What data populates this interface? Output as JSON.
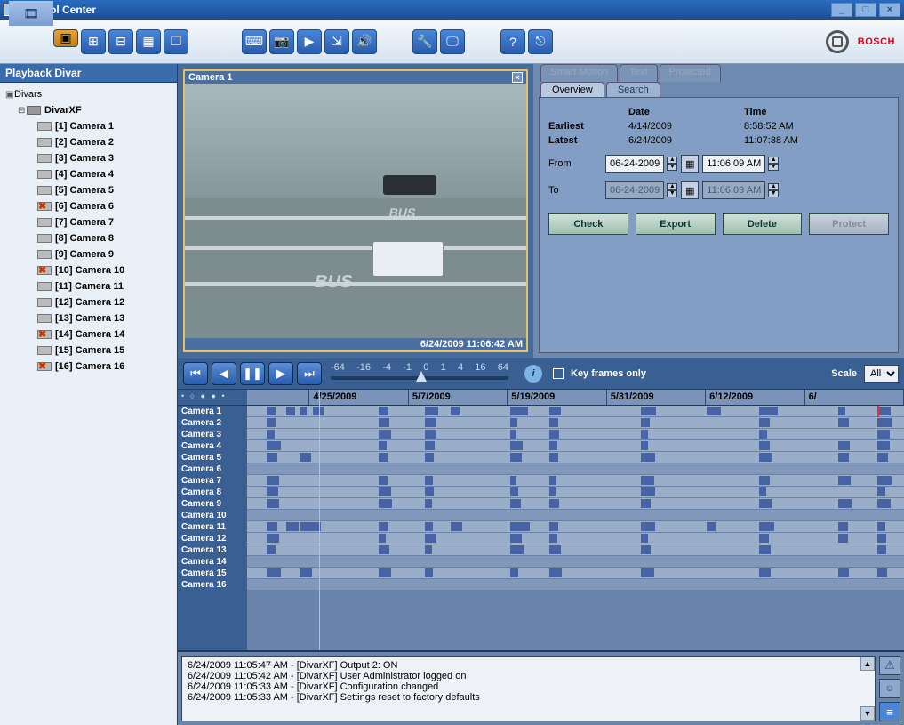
{
  "window": {
    "title": "Control Center"
  },
  "brand": "BOSCH",
  "sidebar": {
    "header": "Playback Divar",
    "root": "Divars",
    "device": "DivarXF",
    "cameras": [
      {
        "label": "[1] Camera 1",
        "off": false
      },
      {
        "label": "[2] Camera 2",
        "off": false
      },
      {
        "label": "[3] Camera 3",
        "off": false
      },
      {
        "label": "[4] Camera 4",
        "off": false
      },
      {
        "label": "[5] Camera 5",
        "off": false
      },
      {
        "label": "[6] Camera 6",
        "off": true
      },
      {
        "label": "[7] Camera 7",
        "off": false
      },
      {
        "label": "[8] Camera 8",
        "off": false
      },
      {
        "label": "[9] Camera 9",
        "off": false
      },
      {
        "label": "[10] Camera 10",
        "off": true
      },
      {
        "label": "[11] Camera 11",
        "off": false
      },
      {
        "label": "[12] Camera 12",
        "off": false
      },
      {
        "label": "[13] Camera 13",
        "off": false
      },
      {
        "label": "[14] Camera 14",
        "off": true
      },
      {
        "label": "[15] Camera 15",
        "off": false
      },
      {
        "label": "[16] Camera 16",
        "off": true
      }
    ]
  },
  "video": {
    "title": "Camera 1",
    "timestamp": "6/24/2009 11:06:42 AM"
  },
  "rtabs": {
    "smart": "Smart Motion",
    "text": "Text",
    "protected": "Protected",
    "overview": "Overview",
    "search": "Search"
  },
  "overview": {
    "hdr_date": "Date",
    "hdr_time": "Time",
    "earliest_lbl": "Earliest",
    "earliest_date": "4/14/2009",
    "earliest_time": "8:58:52 AM",
    "latest_lbl": "Latest",
    "latest_date": "6/24/2009",
    "latest_time": "11:07:38 AM",
    "from_lbl": "From",
    "from_date": "06-24-2009",
    "from_time": "11:06:09 AM",
    "to_lbl": "To",
    "to_date": "06-24-2009",
    "to_time": "11:06:09 AM",
    "btn_check": "Check",
    "btn_export": "Export",
    "btn_delete": "Delete",
    "btn_protect": "Protect"
  },
  "playback": {
    "ticks": [
      "-64",
      "-16",
      "-4",
      "-1",
      "0",
      "1",
      "4",
      "16",
      "64"
    ],
    "keyframes": "Key frames only",
    "scale_lbl": "Scale",
    "scale_val": "All"
  },
  "timeline": {
    "dates": [
      "4/25/2009",
      "5/7/2009",
      "5/19/2009",
      "5/31/2009",
      "6/12/2009",
      "6/"
    ],
    "labels": [
      "Camera 1",
      "Camera 2",
      "Camera 3",
      "Camera 4",
      "Camera 5",
      "Camera 6",
      "Camera 7",
      "Camera 8",
      "Camera 9",
      "Camera 10",
      "Camera 11",
      "Camera 12",
      "Camera 13",
      "Camera 14",
      "Camera 15",
      "Camera 16"
    ]
  },
  "log": [
    "6/24/2009 11:05:47 AM - [DivarXF] Output 2: ON",
    "6/24/2009 11:05:42 AM - [DivarXF] User Administrator logged on",
    "6/24/2009 11:05:33 AM - [DivarXF] Configuration changed",
    "6/24/2009 11:05:33 AM - [DivarXF] Settings reset to factory defaults"
  ]
}
